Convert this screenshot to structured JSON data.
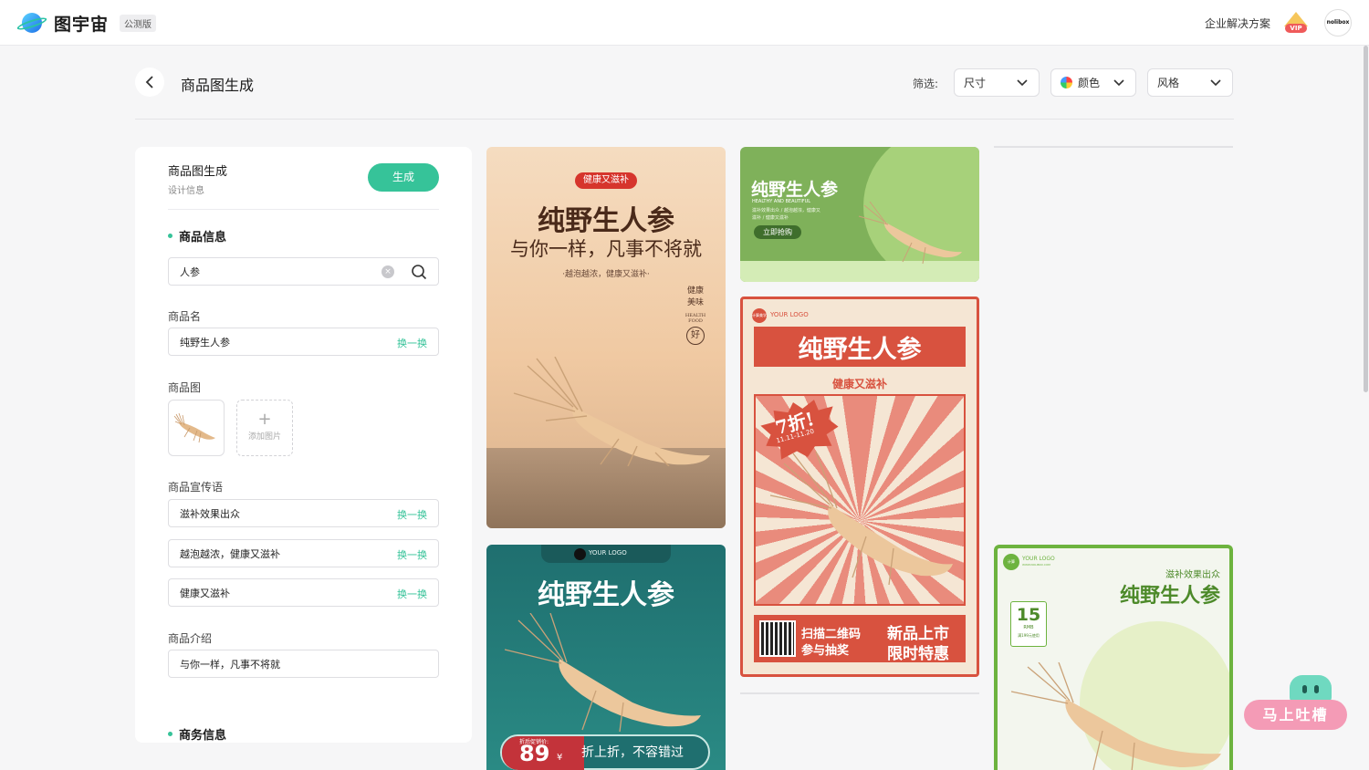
{
  "topbar": {
    "logo_text": "图宇宙",
    "beta_badge": "公测版",
    "enterprise_link": "企业解决方案",
    "vip_label": "VIP",
    "avatar_text": "nolibox"
  },
  "header": {
    "title": "商品图生成",
    "filter_label": "筛选:",
    "filters": [
      {
        "label": "尺寸"
      },
      {
        "label": "颜色"
      },
      {
        "label": "风格"
      }
    ]
  },
  "panel": {
    "title": "商品图生成",
    "subtitle": "设计信息",
    "generate_label": "生成",
    "product_info": {
      "section_title": "商品信息",
      "search_value": "人参",
      "name_label": "商品名",
      "name_value": "纯野生人参",
      "swap_label": "换一换",
      "image_label": "商品图",
      "add_image_label": "添加图片",
      "slogan_label": "商品宣传语",
      "slogans": [
        "滋补效果出众",
        "越泡越浓，健康又滋补",
        "健康又滋补"
      ],
      "intro_label": "商品介绍",
      "intro_value": "与你一样，凡事不将就"
    },
    "business_info": {
      "section_title": "商务信息"
    }
  },
  "cards": {
    "card1": {
      "badge": "健康又滋补",
      "title": "纯野生人参",
      "subtitle": "与你一样，凡事不将就",
      "tagline": "·越泡越浓，健康又滋补·",
      "side_1": "健康",
      "side_2": "美味",
      "side_en_1": "HEALTH",
      "side_en_2": "FOOD",
      "side_circle": "好"
    },
    "card2": {
      "title": "纯野生人参",
      "en": "HEALTHY AND BEAUTIFUL",
      "desc_1": "滋补效果出众 / 越泡越浓，健康又",
      "desc_2": "滋补 / 健康又滋补",
      "cta": "立即抢购"
    },
    "card3": {
      "logo": "YOUR LOGO",
      "logo_badge": "计算美学",
      "title": "纯野生人参",
      "subtitle": "健康又滋补",
      "discount": "7折!",
      "date": "11.11-11.20",
      "qr_1": "扫描二维码",
      "qr_2": "参与抽奖",
      "promo_1": "新品上市",
      "promo_2": "限时特惠"
    },
    "card4": {
      "logo": "YOUR LOGO",
      "title": "纯野生人参",
      "price_label": "折后促销价:",
      "price": "89",
      "currency": "¥",
      "slogan": "折上折，不容错过"
    },
    "card5": {
      "logo": "YOUR LOGO",
      "logo_sub": "WWW.NOLIBOX.COM",
      "tag": "滋补效果出众",
      "title": "纯野生人参",
      "coupon_value": "15",
      "coupon_unit": "RMB",
      "coupon_cond": "满199元使用"
    }
  },
  "feedback": {
    "label": "马上吐槽"
  },
  "colors": {
    "accent": "#36c399",
    "card1_badge": "#d6352c",
    "card2_bg": "#8fbf66",
    "card3_red": "#d8523f",
    "card4_teal": "#1f6f6f",
    "card5_green": "#6db33f"
  }
}
